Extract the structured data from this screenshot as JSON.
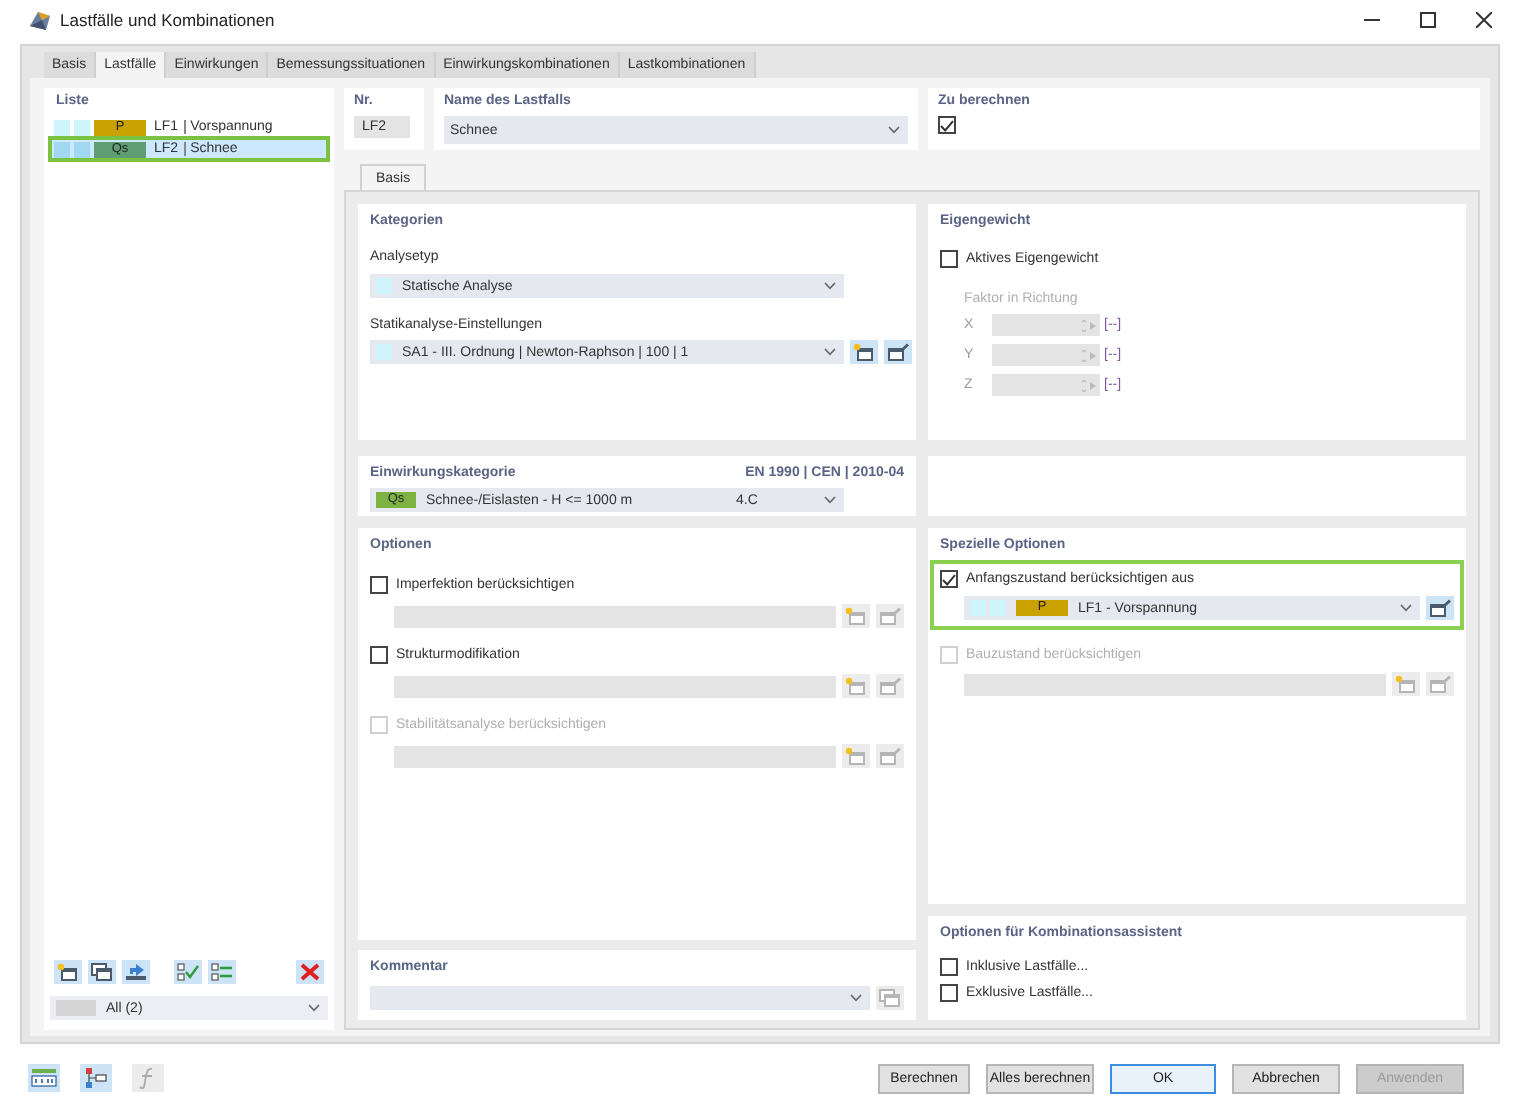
{
  "window": {
    "title": "Lastfälle und Kombinationen"
  },
  "tabs": [
    {
      "label": "Basis",
      "selected": false
    },
    {
      "label": "Lastfälle",
      "selected": true
    },
    {
      "label": "Einwirkungen",
      "selected": false
    },
    {
      "label": "Bemessungssituationen",
      "selected": false
    },
    {
      "label": "Einwirkungskombinationen",
      "selected": false
    },
    {
      "label": "Lastkombinationen",
      "selected": false
    }
  ],
  "list": {
    "title": "Liste",
    "items": [
      {
        "code": "P",
        "color": "#c9a200",
        "number": "LF1",
        "name": "Vorspannung",
        "selected": false
      },
      {
        "code": "Qs",
        "color": "#5e9e72",
        "number": "LF2",
        "name": "Schnee",
        "selected": true
      }
    ],
    "filter": "All (2)"
  },
  "nr": {
    "label": "Nr.",
    "value": "LF2"
  },
  "name": {
    "label": "Name des Lastfalls",
    "value": "Schnee"
  },
  "to_calculate": {
    "label": "Zu berechnen",
    "checked": true
  },
  "subtabs": [
    {
      "label": "Basis",
      "selected": true
    }
  ],
  "kategorien": {
    "title": "Kategorien",
    "analysis_type_label": "Analysetyp",
    "analysis_type": "Statische Analyse",
    "settings_label": "Statikanalyse-Einstellungen",
    "settings": "SA1 - III. Ordnung | Newton-Raphson | 100 | 1"
  },
  "einwirkungskategorie": {
    "title": "Einwirkungskategorie",
    "standard": "EN 1990 | CEN | 2010-04",
    "code": "Qs",
    "color": "#7cb342",
    "value": "Schnee-/Eislasten - H <= 1000 m",
    "number": "4.C"
  },
  "optionen": {
    "title": "Optionen",
    "items": [
      {
        "label": "Imperfektion berücksichtigen",
        "checked": false,
        "disabled": false
      },
      {
        "label": "Strukturmodifikation",
        "checked": false,
        "disabled": false
      },
      {
        "label": "Stabilitätsanalyse berücksichtigen",
        "checked": false,
        "disabled": true
      }
    ]
  },
  "kommentar": {
    "title": "Kommentar"
  },
  "eigengewicht": {
    "title": "Eigengewicht",
    "label": "Aktives Eigengewicht",
    "checked": false,
    "factor_label": "Faktor in Richtung",
    "axes": [
      {
        "axis": "X",
        "unit": "[--]"
      },
      {
        "axis": "Y",
        "unit": "[--]"
      },
      {
        "axis": "Z",
        "unit": "[--]"
      }
    ]
  },
  "spezielle": {
    "title": "Spezielle Optionen",
    "items": [
      {
        "label": "Anfangszustand berücksichtigen aus",
        "checked": true,
        "disabled": false,
        "highlighted": true,
        "code": "P",
        "color": "#c9a200",
        "value": "LF1 - Vorspannung"
      },
      {
        "label": "Bauzustand berücksichtigen",
        "checked": false,
        "disabled": true,
        "highlighted": false
      }
    ]
  },
  "kombination": {
    "title": "Optionen für Kombinationsassistent",
    "items": [
      {
        "label": "Inklusive Lastfälle...",
        "checked": false
      },
      {
        "label": "Exklusive Lastfälle...",
        "checked": false
      }
    ]
  },
  "buttons": [
    {
      "label": "Berechnen",
      "kind": "normal"
    },
    {
      "label": "Alles berechnen",
      "kind": "normal"
    },
    {
      "label": "OK",
      "kind": "default"
    },
    {
      "label": "Abbrechen",
      "kind": "normal"
    },
    {
      "label": "Anwenden",
      "kind": "disabled"
    }
  ]
}
